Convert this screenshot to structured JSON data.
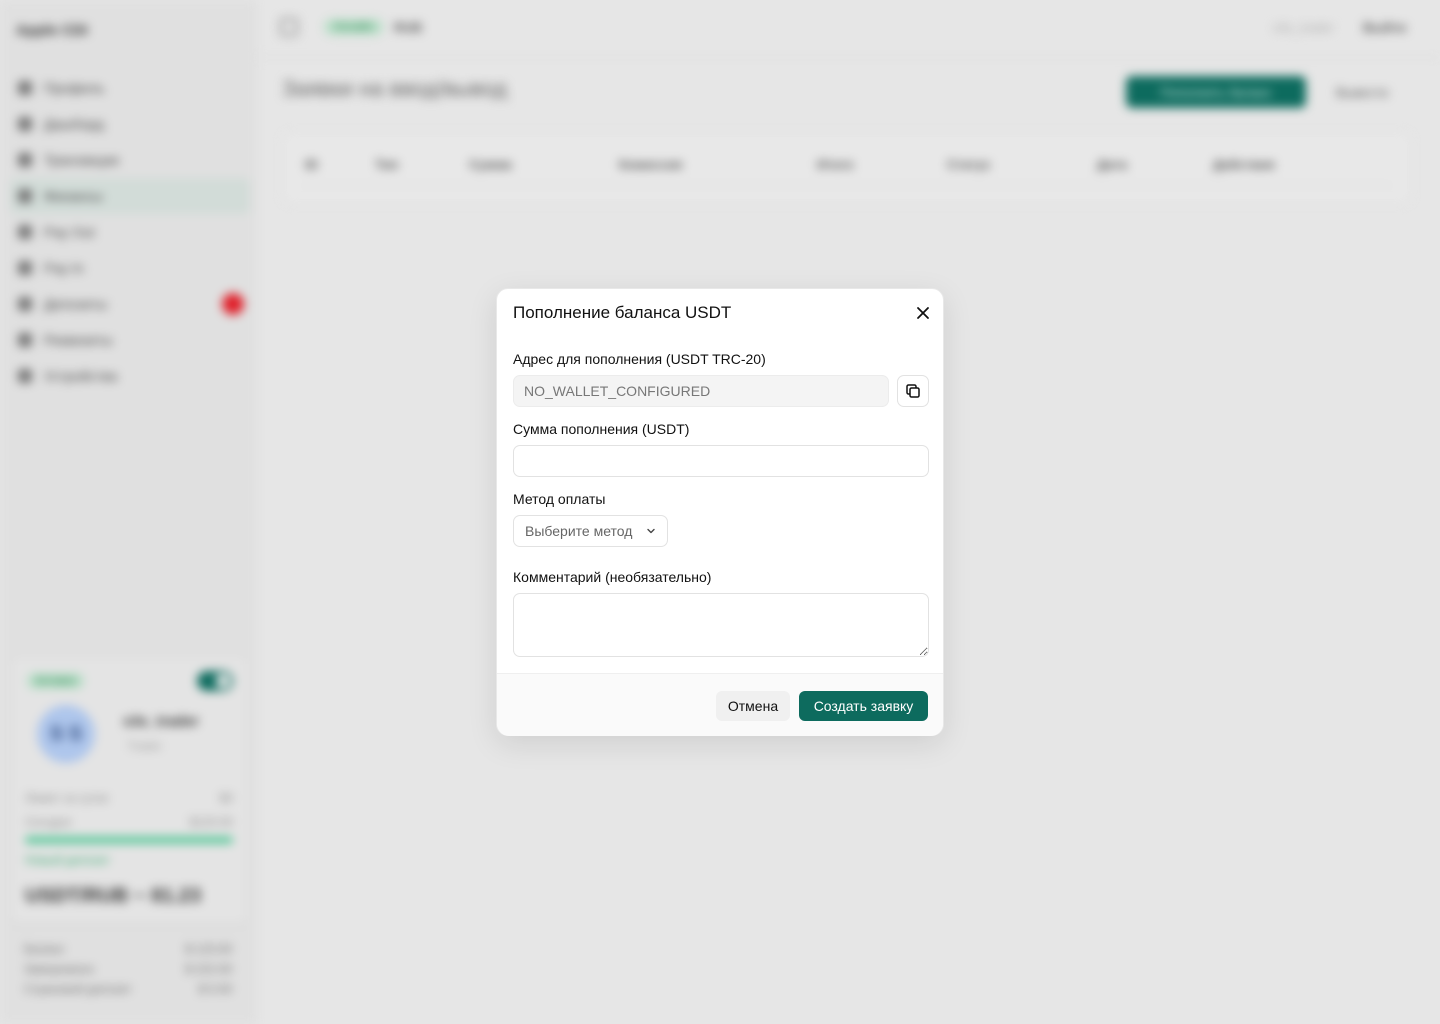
{
  "background": {
    "brand": "Apple CDI",
    "sidebar_items": [
      {
        "label": "Профиль",
        "active": false
      },
      {
        "label": "Дашборд",
        "active": false
      },
      {
        "label": "Транзакции",
        "active": false
      },
      {
        "label": "Финансы",
        "active": true
      },
      {
        "label": "Pay Out",
        "active": false
      },
      {
        "label": "Pay In",
        "active": false
      },
      {
        "label": "Депозиты",
        "active": false
      },
      {
        "label": "Реквизиты",
        "active": false
      },
      {
        "label": "Устройства",
        "active": false
      }
    ],
    "profile": {
      "status": "Активен",
      "initials": "S S",
      "name": "s3s_trader",
      "role": "Trader",
      "limit_label": "Лимит за сутки",
      "limit_value": "$0",
      "today_label": "Сегодня",
      "today_value": "$120.00",
      "progress": 1.0,
      "link": "Новый депозит",
      "rate": "USDT/RUB ~ 81.23"
    },
    "stats": [
      {
        "label": "Баланс",
        "value": "$ 123.00"
      },
      {
        "label": "Замороженo",
        "value": "$ 222.00"
      },
      {
        "label": "Страховой депозит",
        "value": "$ 0.00"
      }
    ],
    "topbar": {
      "status": "Онлайн",
      "currency": "RUB",
      "user": "s3s_trader",
      "exit": "Выйти"
    },
    "page_title": "Заявки на ввод/вывод",
    "deposit_button": "Пополнить баланс",
    "withdraw_button": "Вывести",
    "table_headers": [
      "ID",
      "Тип",
      "Сумма",
      "Комиссия",
      "Итого",
      "Статус",
      "Дата",
      "Действия"
    ]
  },
  "modal": {
    "title": "Пополнение баланса USDT",
    "address_label": "Адрес для пополнения (USDT TRC-20)",
    "address_value": "NO_WALLET_CONFIGURED",
    "amount_label": "Сумма пополнения (USDT)",
    "amount_value": "",
    "method_label": "Метод оплаты",
    "method_placeholder": "Выберите метод",
    "comment_label": "Комментарий (необязательно)",
    "comment_value": "",
    "cancel_button": "Отмена",
    "create_button": "Создать заявку"
  },
  "colors": {
    "accent": "#0d6b5e",
    "badge": "#e0202a",
    "online": "#3cc28a"
  }
}
